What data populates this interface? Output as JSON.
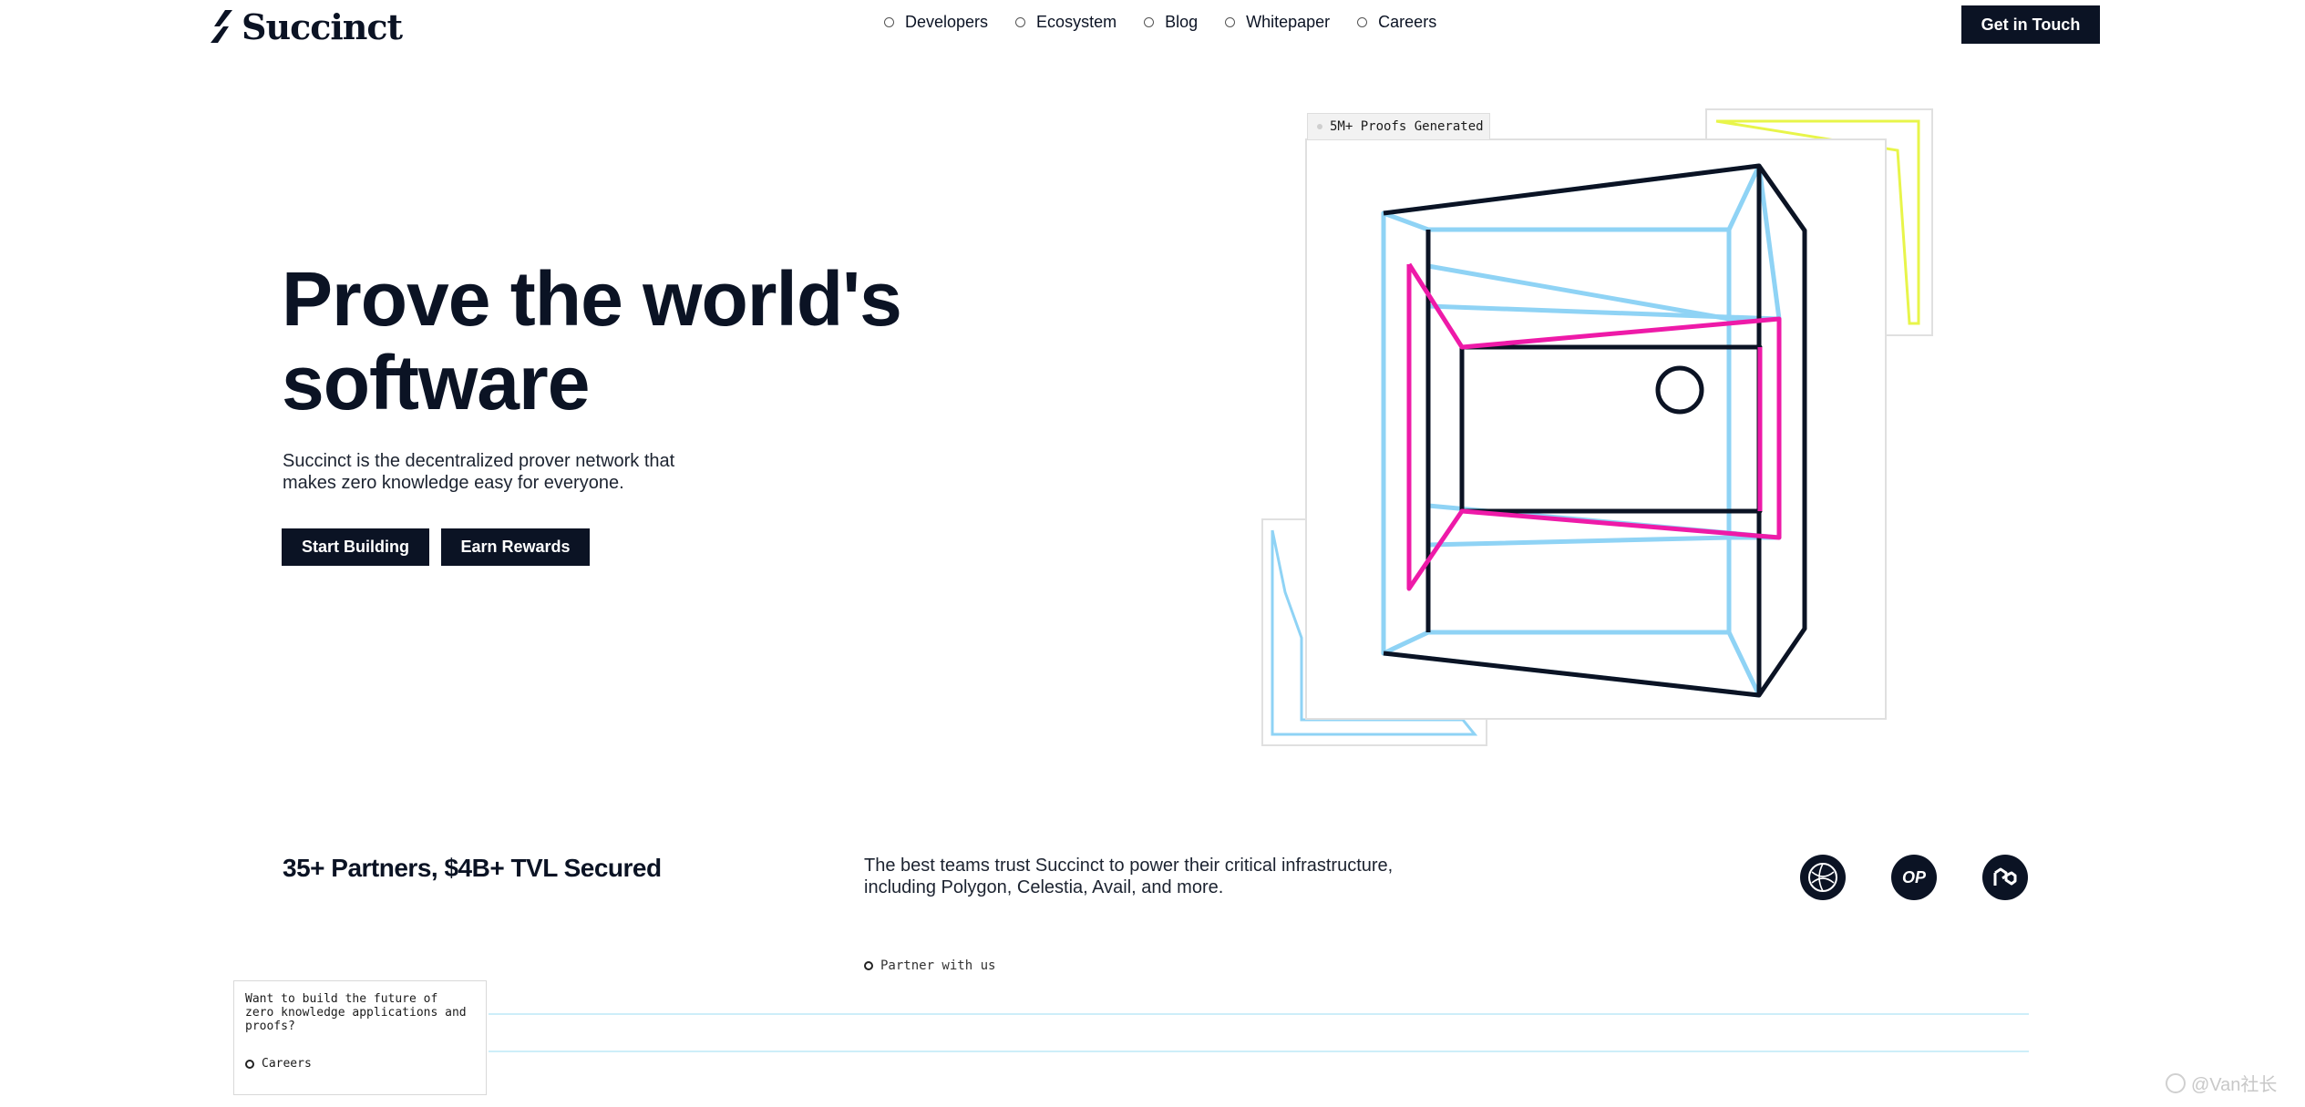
{
  "header": {
    "brand": "Succinct",
    "nav": [
      {
        "label": "Developers"
      },
      {
        "label": "Ecosystem"
      },
      {
        "label": "Blog"
      },
      {
        "label": "Whitepaper"
      },
      {
        "label": "Careers"
      }
    ],
    "cta_label": "Get in Touch"
  },
  "hero": {
    "title_line1": "Prove the world's",
    "title_line2": "software",
    "subtitle": "Succinct is the decentralized prover network that makes zero knowledge easy for everyone.",
    "primary_button": "Start Building",
    "secondary_button": "Earn Rewards",
    "badge": "5M+ Proofs Generated"
  },
  "colors": {
    "navy": "#0b1324",
    "sky": "#8fd3f5",
    "magenta": "#ee1aa8",
    "yellow": "#e8f54a"
  },
  "partners": {
    "title": "35+ Partners, $4B+ TVL Secured",
    "text": "The best teams trust Succinct to power their critical infrastructure, including Polygon, Celestia, Avail, and more.",
    "link": "Partner with us",
    "logos": [
      {
        "icon": "globe-icon"
      },
      {
        "text": "OP"
      },
      {
        "icon": "polygon-icon"
      }
    ]
  },
  "careers_box": {
    "question": "Want to build the future of zero knowledge applications and proofs?",
    "link": "Careers"
  },
  "watermark": "@Van社长"
}
